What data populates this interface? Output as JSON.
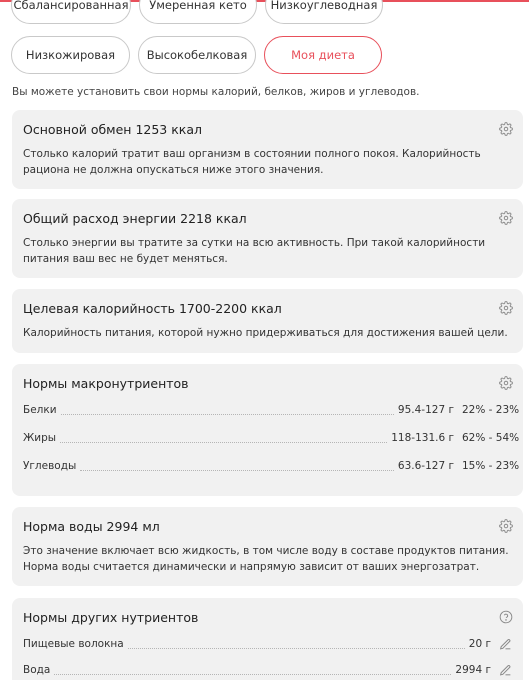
{
  "diet_chips": {
    "row1": [
      "Сбалансированная",
      "Умеренная кето",
      "Низкоуглеводная"
    ],
    "row2": [
      "Низкожировая",
      "Высокобелковая",
      "Моя диета"
    ],
    "active": "Моя диета"
  },
  "hint": "Вы можете установить свои нормы калорий, белков, жиров и углеводов.",
  "bmr": {
    "title": "Основной обмен 1253 ккал",
    "text": "Столько калорий тратит ваш организм в состоянии полного покоя. Калорийность рациона не должна опускаться ниже этого значения."
  },
  "total": {
    "title": "Общий расход энергии 2218 ккал",
    "text": "Столько энергии вы тратите за сутки на всю активность. При такой калорийности питания ваш вес не будет меняться."
  },
  "target": {
    "title": "Целевая калорийность 1700-2200 ккал",
    "text": "Калорийность питания, которой нужно придерживаться для достижения вашей цели."
  },
  "macros": {
    "title": "Нормы макронутриентов",
    "rows": [
      {
        "label": "Белки",
        "value": "95.4-127 г",
        "pct": "22% - 23%"
      },
      {
        "label": "Жиры",
        "value": "118-131.6 г",
        "pct": "62% - 54%"
      },
      {
        "label": "Углеводы",
        "value": "63.6-127 г",
        "pct": "15% - 23%"
      }
    ]
  },
  "water": {
    "title": "Норма воды 2994 мл",
    "text": "Это значение включает всю жидкость, в том числе воду в составе продуктов питания. Норма воды считается динамически и напрямую зависит от ваших энергозатрат."
  },
  "other": {
    "title": "Нормы других нутриентов",
    "rows": [
      {
        "label": "Пищевые волокна",
        "value": "20 г"
      },
      {
        "label": "Вода",
        "value": "2994 г"
      }
    ]
  },
  "colors": {
    "accent": "#e8505b",
    "card_bg": "#f1f1f1"
  }
}
